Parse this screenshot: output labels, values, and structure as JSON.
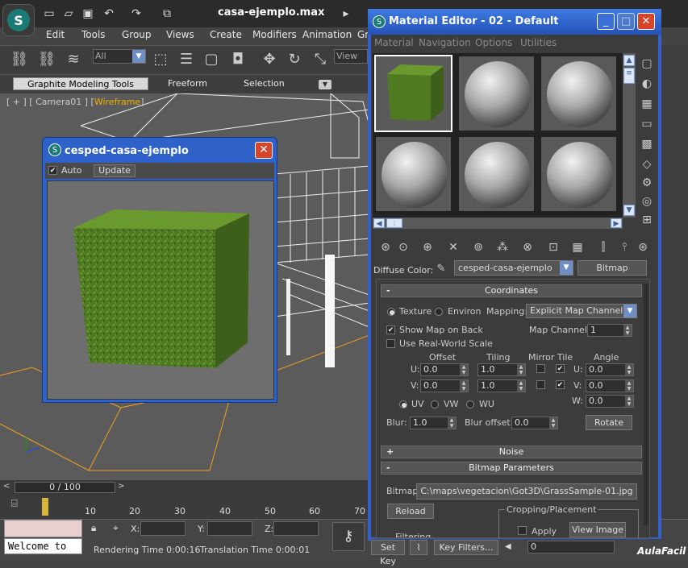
{
  "app": {
    "title": "casa-ejemplo.max",
    "menu": [
      "Edit",
      "Tools",
      "Group",
      "Views",
      "Create",
      "Modifiers",
      "Animation",
      "Gr"
    ],
    "selection_filter": "All",
    "view_combo": "View",
    "ribbon_tabs": [
      "Graphite Modeling Tools",
      "Freeform",
      "Selection"
    ],
    "viewport_label": {
      "prefix": "[ + ] [ Camera01 ] [",
      "mode": "Wireframe",
      "suffix": "]"
    },
    "time_slider": "0 / 100",
    "ruler_ticks": [
      "10",
      "20",
      "30",
      "40",
      "50",
      "60",
      "70"
    ],
    "coords": {
      "x": "X:",
      "y": "Y:",
      "z": "Z:"
    },
    "welcome": "Welcome to",
    "rendering_time": "Rendering Time  0:00:16",
    "translation_time": "Translation Time  0:00:01",
    "set_key": "Set Key",
    "key_filters": "Key Filters...",
    "frame": "0",
    "watermark": "AulaFacil"
  },
  "preview": {
    "title": "cesped-casa-ejemplo",
    "auto_label": "Auto",
    "auto_checked": true,
    "update_label": "Update",
    "colors": {
      "grass_front": "#4f7a22",
      "grass_top": "#6a9a2e",
      "grass_side": "#3d5f1a"
    }
  },
  "material_editor": {
    "title": "Material Editor - 02 - Default",
    "menu": [
      "Material",
      "Navigation",
      "Options",
      "Utilities"
    ],
    "diffuse_label": "Diffuse Color:",
    "material_name": "cesped-casa-ejemplo",
    "material_type": "Bitmap",
    "coordinates": {
      "header": "Coordinates",
      "texture": "Texture",
      "environ": "Environ",
      "mapping_label": "Mapping:",
      "mapping_value": "Explicit Map Channel",
      "show_map_on_back": "Show Map on Back",
      "map_channel_label": "Map Channel:",
      "map_channel_value": "1",
      "real_world": "Use Real-World Scale",
      "col_offset": "Offset",
      "col_tiling": "Tiling",
      "col_mirror_tile": "Mirror Tile",
      "col_angle": "Angle",
      "u_label": "U:",
      "v_label": "V:",
      "w_label": "W:",
      "u_offset": "0.0",
      "v_offset": "0.0",
      "u_tiling": "1.0",
      "v_tiling": "1.0",
      "u_angle": "0.0",
      "v_angle": "0.0",
      "w_angle": "0.0",
      "uv": "UV",
      "vw": "VW",
      "wu": "WU",
      "blur_label": "Blur:",
      "blur_value": "1.0",
      "blur_offset_label": "Blur offset:",
      "blur_offset_value": "0.0",
      "rotate": "Rotate"
    },
    "noise_header": "Noise",
    "bitmap_params": {
      "header": "Bitmap Parameters",
      "bitmap_label": "Bitmap:",
      "path": "C:\\maps\\vegetacion\\Got3D\\GrassSample-01.jpg",
      "reload": "Reload",
      "cropping_label": "Cropping/Placement",
      "apply": "Apply",
      "view_image": "View Image",
      "filtering": "Filtering"
    }
  }
}
